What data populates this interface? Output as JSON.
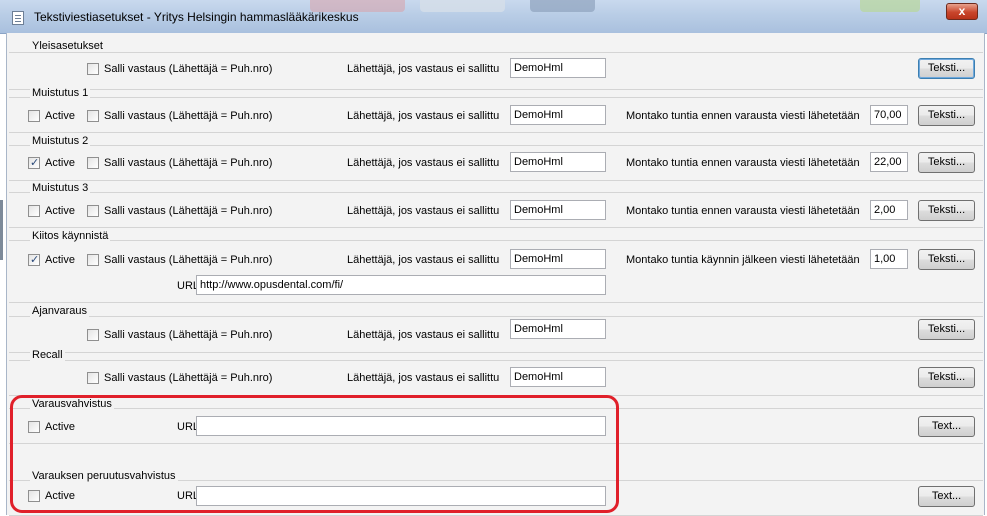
{
  "window": {
    "title": "Tekstiviestiasetukset - Yritys Helsingin hammaslääkärikeskus",
    "close_glyph": "x",
    "icon": "document-icon"
  },
  "groups": {
    "yleis": {
      "label": "Yleisasetukset",
      "allow_reply": {
        "label": "Salli vastaus (Lähettäjä = Puh.nro)",
        "checked": false
      },
      "sender": {
        "label": "Lähettäjä, jos vastaus ei sallittu",
        "value": "DemoHml"
      },
      "text_button": "Teksti..."
    },
    "m1": {
      "label": "Muistutus 1",
      "active": {
        "label": "Active",
        "checked": false
      },
      "allow_reply": {
        "label": "Salli vastaus (Lähettäjä = Puh.nro)",
        "checked": false
      },
      "sender": {
        "label": "Lähettäjä, jos vastaus ei sallittu",
        "value": "DemoHml"
      },
      "hours": {
        "label": "Montako tuntia ennen varausta viesti lähetetään",
        "value": "70,00"
      },
      "text_button": "Teksti..."
    },
    "m2": {
      "label": "Muistutus 2",
      "active": {
        "label": "Active",
        "checked": true
      },
      "allow_reply": {
        "label": "Salli vastaus (Lähettäjä = Puh.nro)",
        "checked": false
      },
      "sender": {
        "label": "Lähettäjä, jos vastaus ei sallittu",
        "value": "DemoHml"
      },
      "hours": {
        "label": "Montako tuntia ennen varausta viesti lähetetään",
        "value": "22,00"
      },
      "text_button": "Teksti..."
    },
    "m3": {
      "label": "Muistutus 3",
      "active": {
        "label": "Active",
        "checked": false
      },
      "allow_reply": {
        "label": "Salli vastaus (Lähettäjä = Puh.nro)",
        "checked": false
      },
      "sender": {
        "label": "Lähettäjä, jos vastaus ei sallittu",
        "value": "DemoHml"
      },
      "hours": {
        "label": "Montako tuntia ennen varausta viesti lähetetään",
        "value": "2,00"
      },
      "text_button": "Teksti..."
    },
    "kitos": {
      "label": "Kiitos käynnistä",
      "active": {
        "label": "Active",
        "checked": true
      },
      "allow_reply": {
        "label": "Salli vastaus (Lähettäjä = Puh.nro)",
        "checked": false
      },
      "sender": {
        "label": "Lähettäjä, jos vastaus ei sallittu",
        "value": "DemoHml"
      },
      "hours": {
        "label": "Montako tuntia käynnin jälkeen viesti lähetetään",
        "value": "1,00"
      },
      "url": {
        "label": "URL",
        "value": "http://www.opusdental.com/fi/"
      },
      "text_button": "Teksti..."
    },
    "ajan": {
      "label": "Ajanvaraus",
      "allow_reply": {
        "label": "Salli vastaus (Lähettäjä = Puh.nro)",
        "checked": false
      },
      "sender": {
        "label": "Lähettäjä, jos vastaus ei sallittu",
        "value": "DemoHml"
      },
      "text_button": "Teksti..."
    },
    "recall": {
      "label": "Recall",
      "allow_reply": {
        "label": "Salli vastaus (Lähettäjä = Puh.nro)",
        "checked": false
      },
      "sender": {
        "label": "Lähettäjä, jos vastaus ei sallittu",
        "value": "DemoHml"
      },
      "text_button": "Teksti..."
    },
    "varaus": {
      "label": "Varausvahvistus",
      "active": {
        "label": "Active",
        "checked": false
      },
      "url": {
        "label": "URL",
        "value": ""
      },
      "text_button": "Text..."
    },
    "peruutus": {
      "label": "Varauksen peruutusvahvistus",
      "active": {
        "label": "Active",
        "checked": false
      },
      "url": {
        "label": "URL",
        "value": ""
      },
      "text_button": "Text..."
    }
  },
  "colors": {
    "highlight": "#e0202a",
    "dialog_bg": "#f3f3f3",
    "titlebar": "#b9cde6",
    "close": "#c9462c"
  }
}
